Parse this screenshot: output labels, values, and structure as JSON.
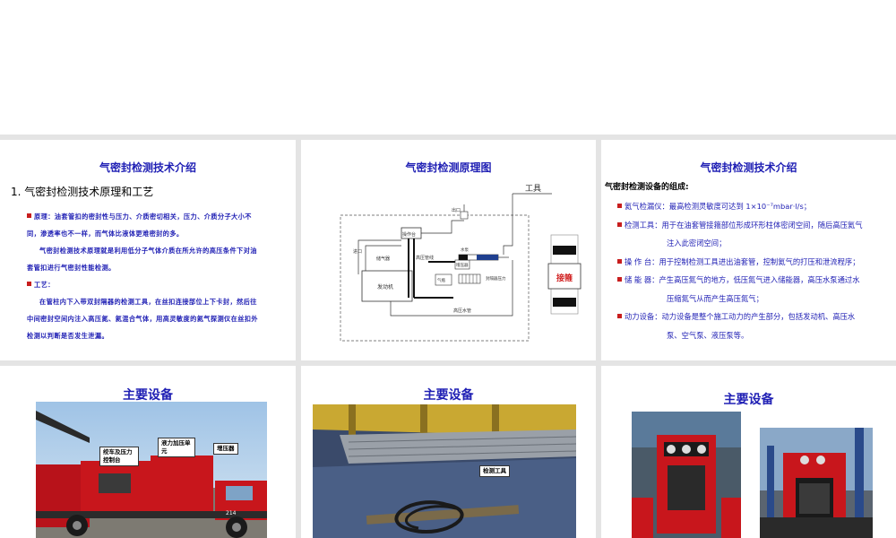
{
  "slide1": {
    "title": "气密封检测技术介绍",
    "heading": "1. 气密封检测技术原理和工艺",
    "principle": "原理：油套管扣的密封性与压力、介质密切相关，压力、介质分子大小不同，渗透率也不一样，而气体比液体更难密封的多。",
    "principle2": "气密封检测技术原理就是利用低分子气体介质在所允许的高压条件下对油套管扣进行气密封性能检测。",
    "process_label": "工艺：",
    "process": "在管柱内下入带双封隔器的检测工具，在丝扣连接部位上下卡封，然后往中间密封空间内注入高压氮、氦混合气体，用高灵敏度的氦气探测仪在丝扣外检测以判断是否发生泄漏。"
  },
  "slide2": {
    "title": "气密封检测原理图",
    "labels": {
      "tool": "工具",
      "engine": "发动机",
      "outlet": "出口",
      "inlet": "进口",
      "control": "操作台",
      "high_pressure_line": "高压管线",
      "gas_storage": "储气器",
      "gas_cylinder": "气瓶",
      "booster": "增压器",
      "packer_pressure": "封隔器压力",
      "hp_water": "高压水管",
      "collar": "接箍",
      "pump": "水泵"
    }
  },
  "slide3": {
    "title": "气密封检测技术介绍",
    "intro": "气密封检测设备的组成:",
    "items": [
      {
        "label": "氦气检漏仪：",
        "text": "最高检测灵敏度可达到 1×10⁻⁷mbar·l/s；",
        "cont": ""
      },
      {
        "label": "检测工具：",
        "text": "用于在油套管接箍部位形成环形柱体密闭空间，随后高压氦气",
        "cont": "注入此密闭空间；"
      },
      {
        "label": "操 作 台：",
        "text": "用于控制检测工具进出油套管，控制氦气的打压和泄流程序；",
        "cont": ""
      },
      {
        "label": "储 能 器：",
        "text": "产生高压氮气的地方，低压氮气进入储能器，高压水泵通过水",
        "cont": "压缩氮气从而产生高压氮气；"
      },
      {
        "label": "动力设备：",
        "text": "动力设备是整个施工动力的产生部分，包括发动机、高压水",
        "cont": "泵、空气泵、液压泵等。"
      }
    ]
  },
  "slide4": {
    "title": "主要设备",
    "callouts": [
      "绞车及压力控制台",
      "液力加压单元",
      "增压器"
    ]
  },
  "slide5": {
    "title": "主要设备",
    "callout": "检测工具"
  },
  "slide6": {
    "title": "主要设备"
  },
  "colors": {
    "title_blue": "#1f1fb4",
    "bullet_red": "#c81e1e",
    "truck_red": "#c8161c",
    "background_gray": "#e4e4e4"
  }
}
